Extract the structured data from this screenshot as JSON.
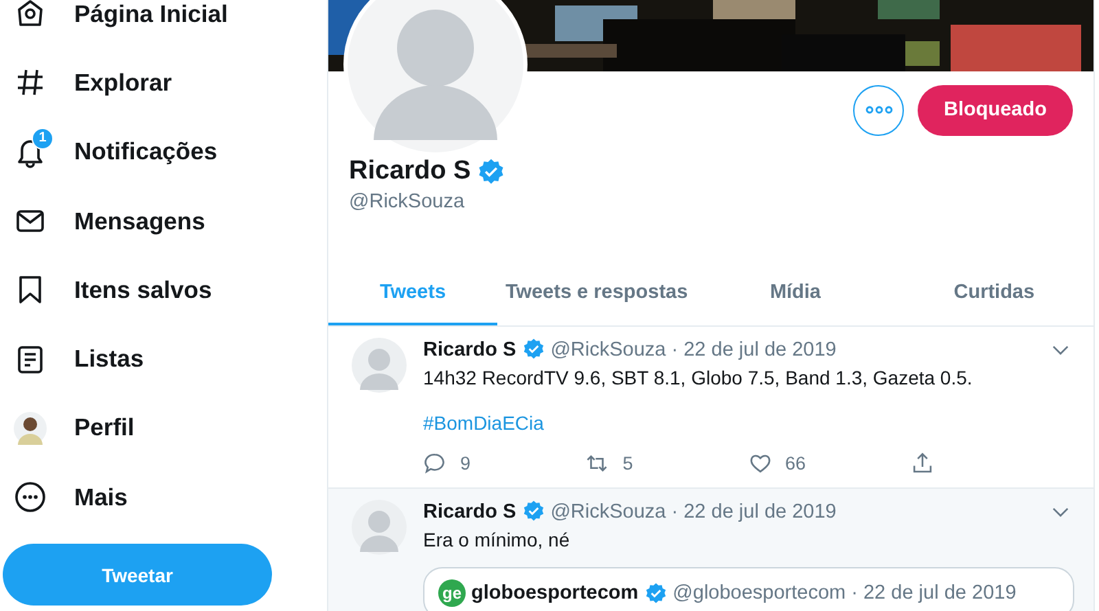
{
  "sidebar": {
    "items": [
      {
        "kind": "home",
        "label": "Página Inicial"
      },
      {
        "kind": "hash",
        "label": "Explorar"
      },
      {
        "kind": "bell",
        "label": "Notificações",
        "badge": "1"
      },
      {
        "kind": "mail",
        "label": "Mensagens"
      },
      {
        "kind": "bookmark",
        "label": "Itens salvos"
      },
      {
        "kind": "list",
        "label": "Listas"
      },
      {
        "kind": "avatar",
        "label": "Perfil"
      },
      {
        "kind": "more",
        "label": "Mais"
      }
    ],
    "tweet_button": "Tweetar"
  },
  "profile": {
    "name": "Ricardo S",
    "verified": true,
    "handle": "@RickSouza",
    "block_button": "Bloqueado"
  },
  "tabs": [
    {
      "label": "Tweets",
      "selected": true
    },
    {
      "label": "Tweets e respostas",
      "selected": false
    },
    {
      "label": "Mídia",
      "selected": false
    },
    {
      "label": "Curtidas",
      "selected": false
    }
  ],
  "tweets": [
    {
      "name": "Ricardo S",
      "verified": true,
      "meta": "@RickSouza · 22 de jul de 2019",
      "text": "14h32 RecordTV 9.6, SBT 8.1, Globo 7.5, Band 1.3, Gazeta 0.5.",
      "hashtag": "#BomDiaECia",
      "highlighted": false,
      "stats": {
        "replies": "9",
        "retweets": "5",
        "likes": "66"
      }
    },
    {
      "name": "Ricardo S",
      "verified": true,
      "meta": "@RickSouza · 22 de jul de 2019",
      "text": "Era o mínimo, né",
      "highlighted": true,
      "quote": {
        "logo": "ge",
        "name": "globoesportecom",
        "verified": true,
        "meta": "@globoesportecom · 22 de jul de 2019"
      }
    }
  ]
}
